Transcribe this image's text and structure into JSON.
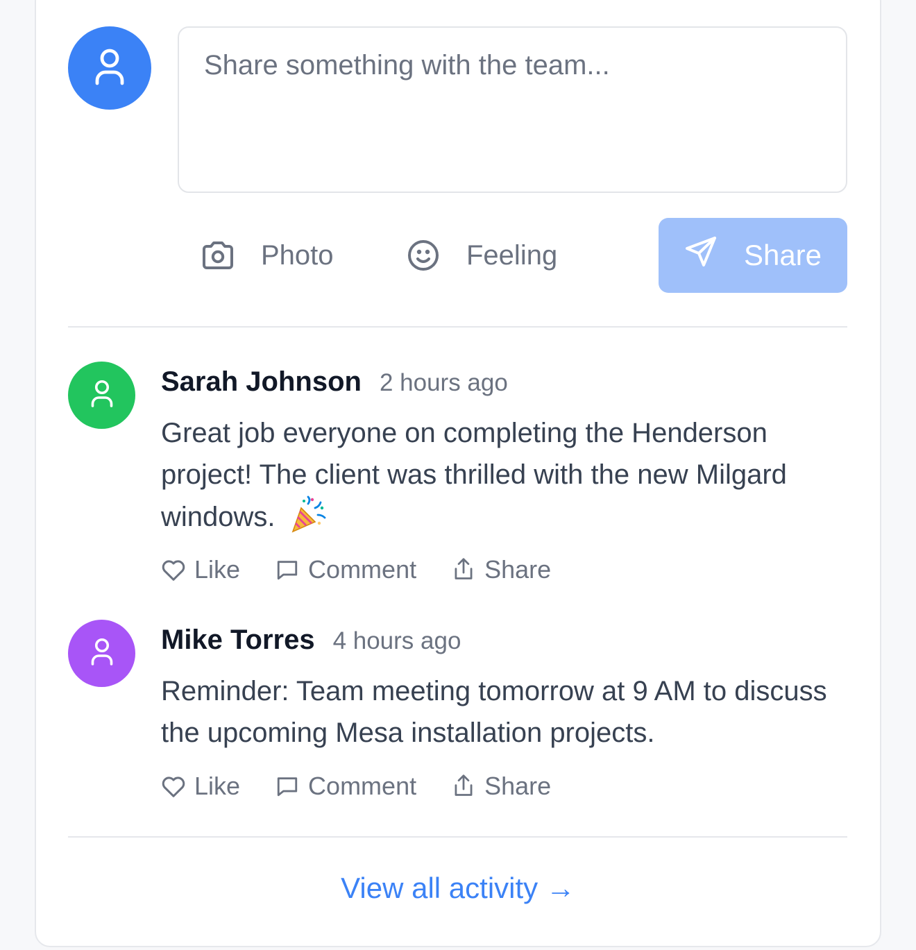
{
  "composer": {
    "placeholder": "Share something with the team...",
    "avatar_icon": "user-icon",
    "avatar_color": "#3b82f6",
    "tools": [
      {
        "label": "Photo",
        "icon": "camera-icon"
      },
      {
        "label": "Feeling",
        "icon": "smile-icon"
      }
    ],
    "share_label": "Share",
    "share_icon": "send-icon",
    "share_color": "#9fc0fa"
  },
  "posts": [
    {
      "author": "Sarah Johnson",
      "time": "2 hours ago",
      "body": "Great job everyone on completing the Henderson project! The client was thrilled with the new Milgard windows.",
      "emoji": "party-popper-icon",
      "avatar_color": "#22c55e",
      "actions": [
        "Like",
        "Comment",
        "Share"
      ]
    },
    {
      "author": "Mike Torres",
      "time": "4 hours ago",
      "body": "Reminder: Team meeting tomorrow at 9 AM to discuss the upcoming Mesa installation projects.",
      "avatar_color": "#a855f7",
      "actions": [
        "Like",
        "Comment",
        "Share"
      ]
    }
  ],
  "footer": {
    "view_all_label": "View all activity →",
    "link_color": "#3b82f6"
  }
}
